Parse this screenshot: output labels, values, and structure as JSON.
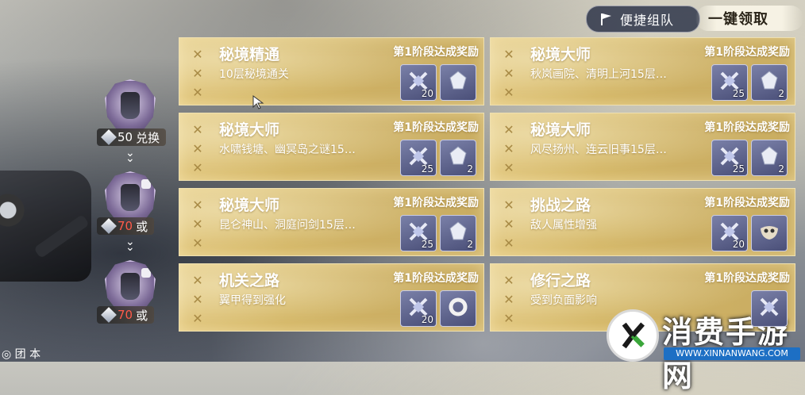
{
  "header": {
    "quick_team_label": "便捷组队",
    "claim_all_label": "一键领取"
  },
  "progression": {
    "tiers": [
      {
        "cost": "50",
        "label_suffix": "兑换",
        "locked": false
      },
      {
        "cost": "70",
        "label_suffix": "或",
        "locked": true
      },
      {
        "cost": "70",
        "label_suffix": "或",
        "locked": true
      }
    ],
    "bottom_label": "◎ 团 本"
  },
  "quests": [
    {
      "title": "秘境精通",
      "desc": "10层秘境通关",
      "stage": "第1阶段达成奖励",
      "rewards": [
        {
          "icon": "crossed-swords-icon",
          "qty": "20"
        },
        {
          "icon": "crystal-icon",
          "qty": ""
        }
      ]
    },
    {
      "title": "秘境大师",
      "desc": "秋岚画院、清明上河15层…",
      "stage": "第1阶段达成奖励",
      "rewards": [
        {
          "icon": "crossed-swords-icon",
          "qty": "25"
        },
        {
          "icon": "crystal-icon",
          "qty": "2"
        }
      ]
    },
    {
      "title": "秘境大师",
      "desc": "水啸钱塘、幽冥岛之谜15…",
      "stage": "第1阶段达成奖励",
      "rewards": [
        {
          "icon": "crossed-swords-icon",
          "qty": "25"
        },
        {
          "icon": "crystal-icon",
          "qty": "2"
        }
      ]
    },
    {
      "title": "秘境大师",
      "desc": "风尽扬州、连云旧事15层…",
      "stage": "第1阶段达成奖励",
      "rewards": [
        {
          "icon": "crossed-swords-icon",
          "qty": "25"
        },
        {
          "icon": "crystal-icon",
          "qty": "2"
        }
      ]
    },
    {
      "title": "秘境大师",
      "desc": "昆仑神山、洞庭问剑15层…",
      "stage": "第1阶段达成奖励",
      "rewards": [
        {
          "icon": "crossed-swords-icon",
          "qty": "25"
        },
        {
          "icon": "crystal-icon",
          "qty": "2"
        }
      ]
    },
    {
      "title": "挑战之路",
      "desc": "敌人属性增强",
      "stage": "第1阶段达成奖励",
      "rewards": [
        {
          "icon": "crossed-swords-icon",
          "qty": "20"
        },
        {
          "icon": "mask-icon",
          "qty": ""
        }
      ]
    },
    {
      "title": "机关之路",
      "desc": "翼甲得到强化",
      "stage": "第1阶段达成奖励",
      "rewards": [
        {
          "icon": "crossed-swords-icon",
          "qty": "20"
        },
        {
          "icon": "ring-icon",
          "qty": ""
        }
      ]
    },
    {
      "title": "修行之路",
      "desc": "受到负面影响",
      "stage": "第1阶段达成奖励",
      "rewards": [
        {
          "icon": "crossed-swords-icon",
          "qty": ""
        }
      ]
    }
  ],
  "watermark": {
    "title": "消费手游网",
    "url": "WWW.XINNANWANG.COM"
  }
}
